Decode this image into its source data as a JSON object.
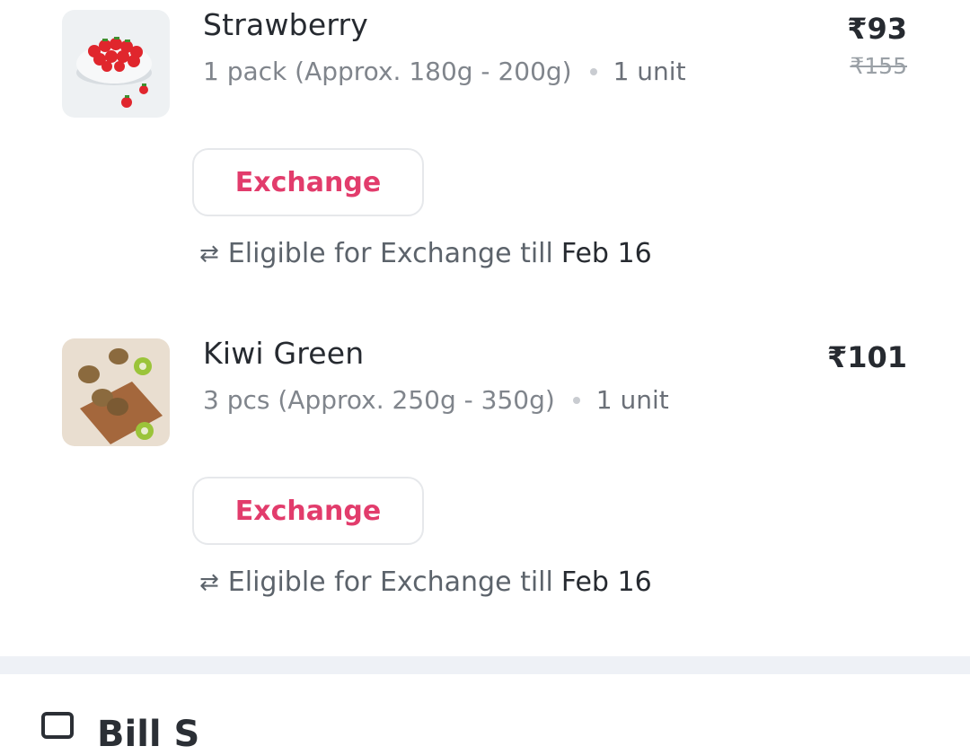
{
  "items": [
    {
      "name": "Strawberry",
      "pack": "1 pack (Approx. 180g - 200g)",
      "quantity": "1 unit",
      "price": "₹93",
      "mrp": "₹155",
      "exchange_label": "Exchange",
      "eligible_text": "Eligible for Exchange till",
      "eligible_date": "Feb 16"
    },
    {
      "name": "Kiwi Green",
      "pack": "3 pcs (Approx. 250g - 350g)",
      "quantity": "1 unit",
      "price": "₹101",
      "exchange_label": "Exchange",
      "eligible_text": "Eligible for Exchange till",
      "eligible_date": "Feb 16"
    }
  ],
  "bill": {
    "title": "Bill S"
  },
  "icons": {
    "swap": "exchange-arrows-icon",
    "bill": "bill-icon"
  },
  "colors": {
    "accent": "#e23c6c",
    "divider": "#eef1f6"
  }
}
